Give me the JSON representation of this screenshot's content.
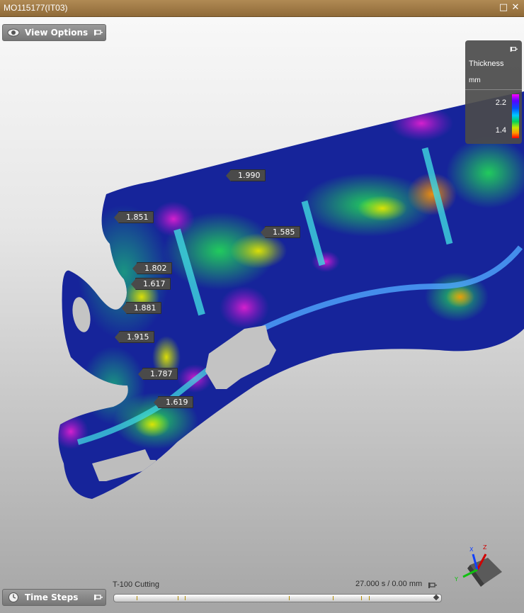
{
  "window": {
    "title": "MO115177(IT03)"
  },
  "view_options": {
    "label": "View Options"
  },
  "time_steps": {
    "label": "Time Steps"
  },
  "legend": {
    "title": "Thickness",
    "unit": "mm",
    "max_label": "2.2",
    "min_label": "1.4"
  },
  "probes": [
    {
      "value": "1.990"
    },
    {
      "value": "1.851"
    },
    {
      "value": "1.585"
    },
    {
      "value": "1.802"
    },
    {
      "value": "1.617"
    },
    {
      "value": "1.881"
    },
    {
      "value": "1.915"
    },
    {
      "value": "1.787"
    },
    {
      "value": "1.619"
    }
  ],
  "timeline": {
    "step_name": "T-100 Cutting",
    "time_readout": "27.000 s / 0.00 mm"
  },
  "axes": {
    "x": "X",
    "y": "Y",
    "z": "Z"
  },
  "colors": {
    "accent": "#9a7442",
    "panel": "#858585",
    "tag": "#4a4a4a"
  },
  "icons": {
    "view_options": "eye-icon",
    "time_steps": "clock-icon",
    "pin": "pin-icon",
    "maximize": "maximize-icon",
    "close": "close-icon"
  }
}
